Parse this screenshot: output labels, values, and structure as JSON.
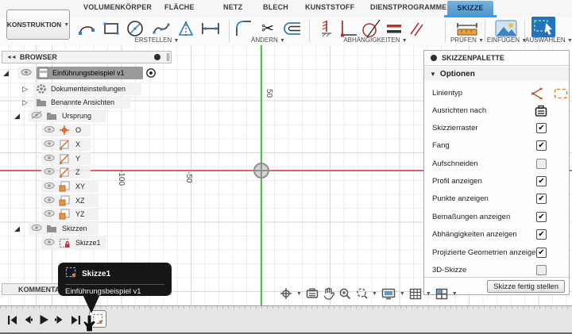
{
  "ribbon": {
    "context_button": {
      "label": "KONSTRUKTION"
    },
    "tabs": [
      {
        "label": "VOLUMENKÖRPER",
        "active": false
      },
      {
        "label": "FLÄCHE",
        "active": false
      },
      {
        "label": "NETZ",
        "active": false
      },
      {
        "label": "BLECH",
        "active": false
      },
      {
        "label": "KUNSTSTOFF",
        "active": false
      },
      {
        "label": "DIENSTPROGRAMME",
        "active": false
      },
      {
        "label": "SKIZZE",
        "active": true
      }
    ],
    "groups": [
      {
        "label": "ERSTELLEN",
        "icons": [
          "line-icon",
          "rectangle-icon",
          "circle-icon",
          "spline-icon",
          "mirror-icon",
          "dimension-icon"
        ]
      },
      {
        "label": "ÄNDERN",
        "icons": [
          "fillet-icon",
          "trim-scissors-icon",
          "offset-icon"
        ]
      },
      {
        "label": "ABHÄNGIGKEITEN",
        "icons": [
          "fixed-constraint-icon",
          "perpendicular-constraint-icon",
          "tangent-constraint-icon",
          "equal-constraint-icon",
          "parallel-constraint-icon"
        ]
      },
      {
        "label": "PRÜFEN",
        "icons": [
          "measure-icon"
        ]
      },
      {
        "label": "EINFÜGEN",
        "icons": [
          "insert-image-icon"
        ]
      },
      {
        "label": "AUSWÄHLEN",
        "icons": [
          "select-icon"
        ]
      }
    ]
  },
  "browser": {
    "header": "BROWSER",
    "comments_label": "KOMMENTARE",
    "items": [
      {
        "label": "Einführungsbeispiel v1",
        "icon": "document-icon",
        "selected": true,
        "visible": true
      },
      {
        "label": "Dokumenteinstellungen",
        "icon": "gear-icon"
      },
      {
        "label": "Benannte Ansichten",
        "icon": "folder-icon"
      },
      {
        "label": "Ursprung",
        "icon": "folder-icon",
        "visible": false
      },
      {
        "label": "O",
        "icon": "origin-point-icon",
        "visible": true
      },
      {
        "label": "X",
        "icon": "axis-icon",
        "visible": true
      },
      {
        "label": "Y",
        "icon": "axis-icon",
        "visible": true
      },
      {
        "label": "Z",
        "icon": "axis-icon",
        "visible": true
      },
      {
        "label": "XY",
        "icon": "plane-icon",
        "visible": true
      },
      {
        "label": "XZ",
        "icon": "plane-icon",
        "visible": true
      },
      {
        "label": "YZ",
        "icon": "plane-icon",
        "visible": true
      },
      {
        "label": "Skizzen",
        "icon": "folder-icon",
        "visible": true
      },
      {
        "label": "Skizze1",
        "icon": "sketch-locked-icon",
        "visible": true
      }
    ]
  },
  "canvas": {
    "axis_tick_labels": [
      {
        "text": "50",
        "axis": "y"
      },
      {
        "text": "-50",
        "axis": "x"
      },
      {
        "text": "-100",
        "axis": "x"
      }
    ],
    "colors": {
      "x_axis": "#e0635c",
      "y_axis": "#46c546",
      "grid_minor": "#ededed",
      "grid_major": "#d7d7d7"
    }
  },
  "palette": {
    "title": "SKIZZENPALETTE",
    "section_header": "Optionen",
    "rows": [
      {
        "label": "Linientyp",
        "control": "icons",
        "icons": [
          "linetype-spline-icon",
          "linetype-construction-icon"
        ]
      },
      {
        "label": "Ausrichten nach",
        "control": "icon",
        "icons": [
          "align-to-grid-icon"
        ]
      },
      {
        "label": "Skizzierraster",
        "control": "checkbox",
        "checked": true
      },
      {
        "label": "Fang",
        "control": "checkbox",
        "checked": true
      },
      {
        "label": "Aufschneiden",
        "control": "checkbox",
        "checked": false
      },
      {
        "label": "Profil anzeigen",
        "control": "checkbox",
        "checked": true
      },
      {
        "label": "Punkte anzeigen",
        "control": "checkbox",
        "checked": true
      },
      {
        "label": "Bemaßungen anzeigen",
        "control": "checkbox",
        "checked": true
      },
      {
        "label": "Abhängigkeiten anzeigen",
        "control": "checkbox",
        "checked": true
      },
      {
        "label": "Projizierte Geometrien anzeigen",
        "control": "checkbox",
        "checked": true
      },
      {
        "label": "3D-Skizze",
        "control": "checkbox",
        "checked": false
      }
    ],
    "finish_button": "Skizze fertig stellen"
  },
  "tooltip": {
    "title": "Skizze1",
    "subtitle": "Einführungsbeispiel v1"
  },
  "timeline": {
    "playback_icons": [
      "go-to-start-icon",
      "step-back-icon",
      "play-icon",
      "step-forward-icon",
      "go-to-end-icon"
    ],
    "features": [
      {
        "icon": "sketch-feature-icon",
        "tooltip_target": true
      }
    ]
  },
  "navbar_icons": [
    "orbit-icon",
    "look-at-icon",
    "pan-icon",
    "zoom-icon",
    "zoom-window-icon",
    "display-settings-icon",
    "grid-settings-icon",
    "viewports-icon"
  ]
}
